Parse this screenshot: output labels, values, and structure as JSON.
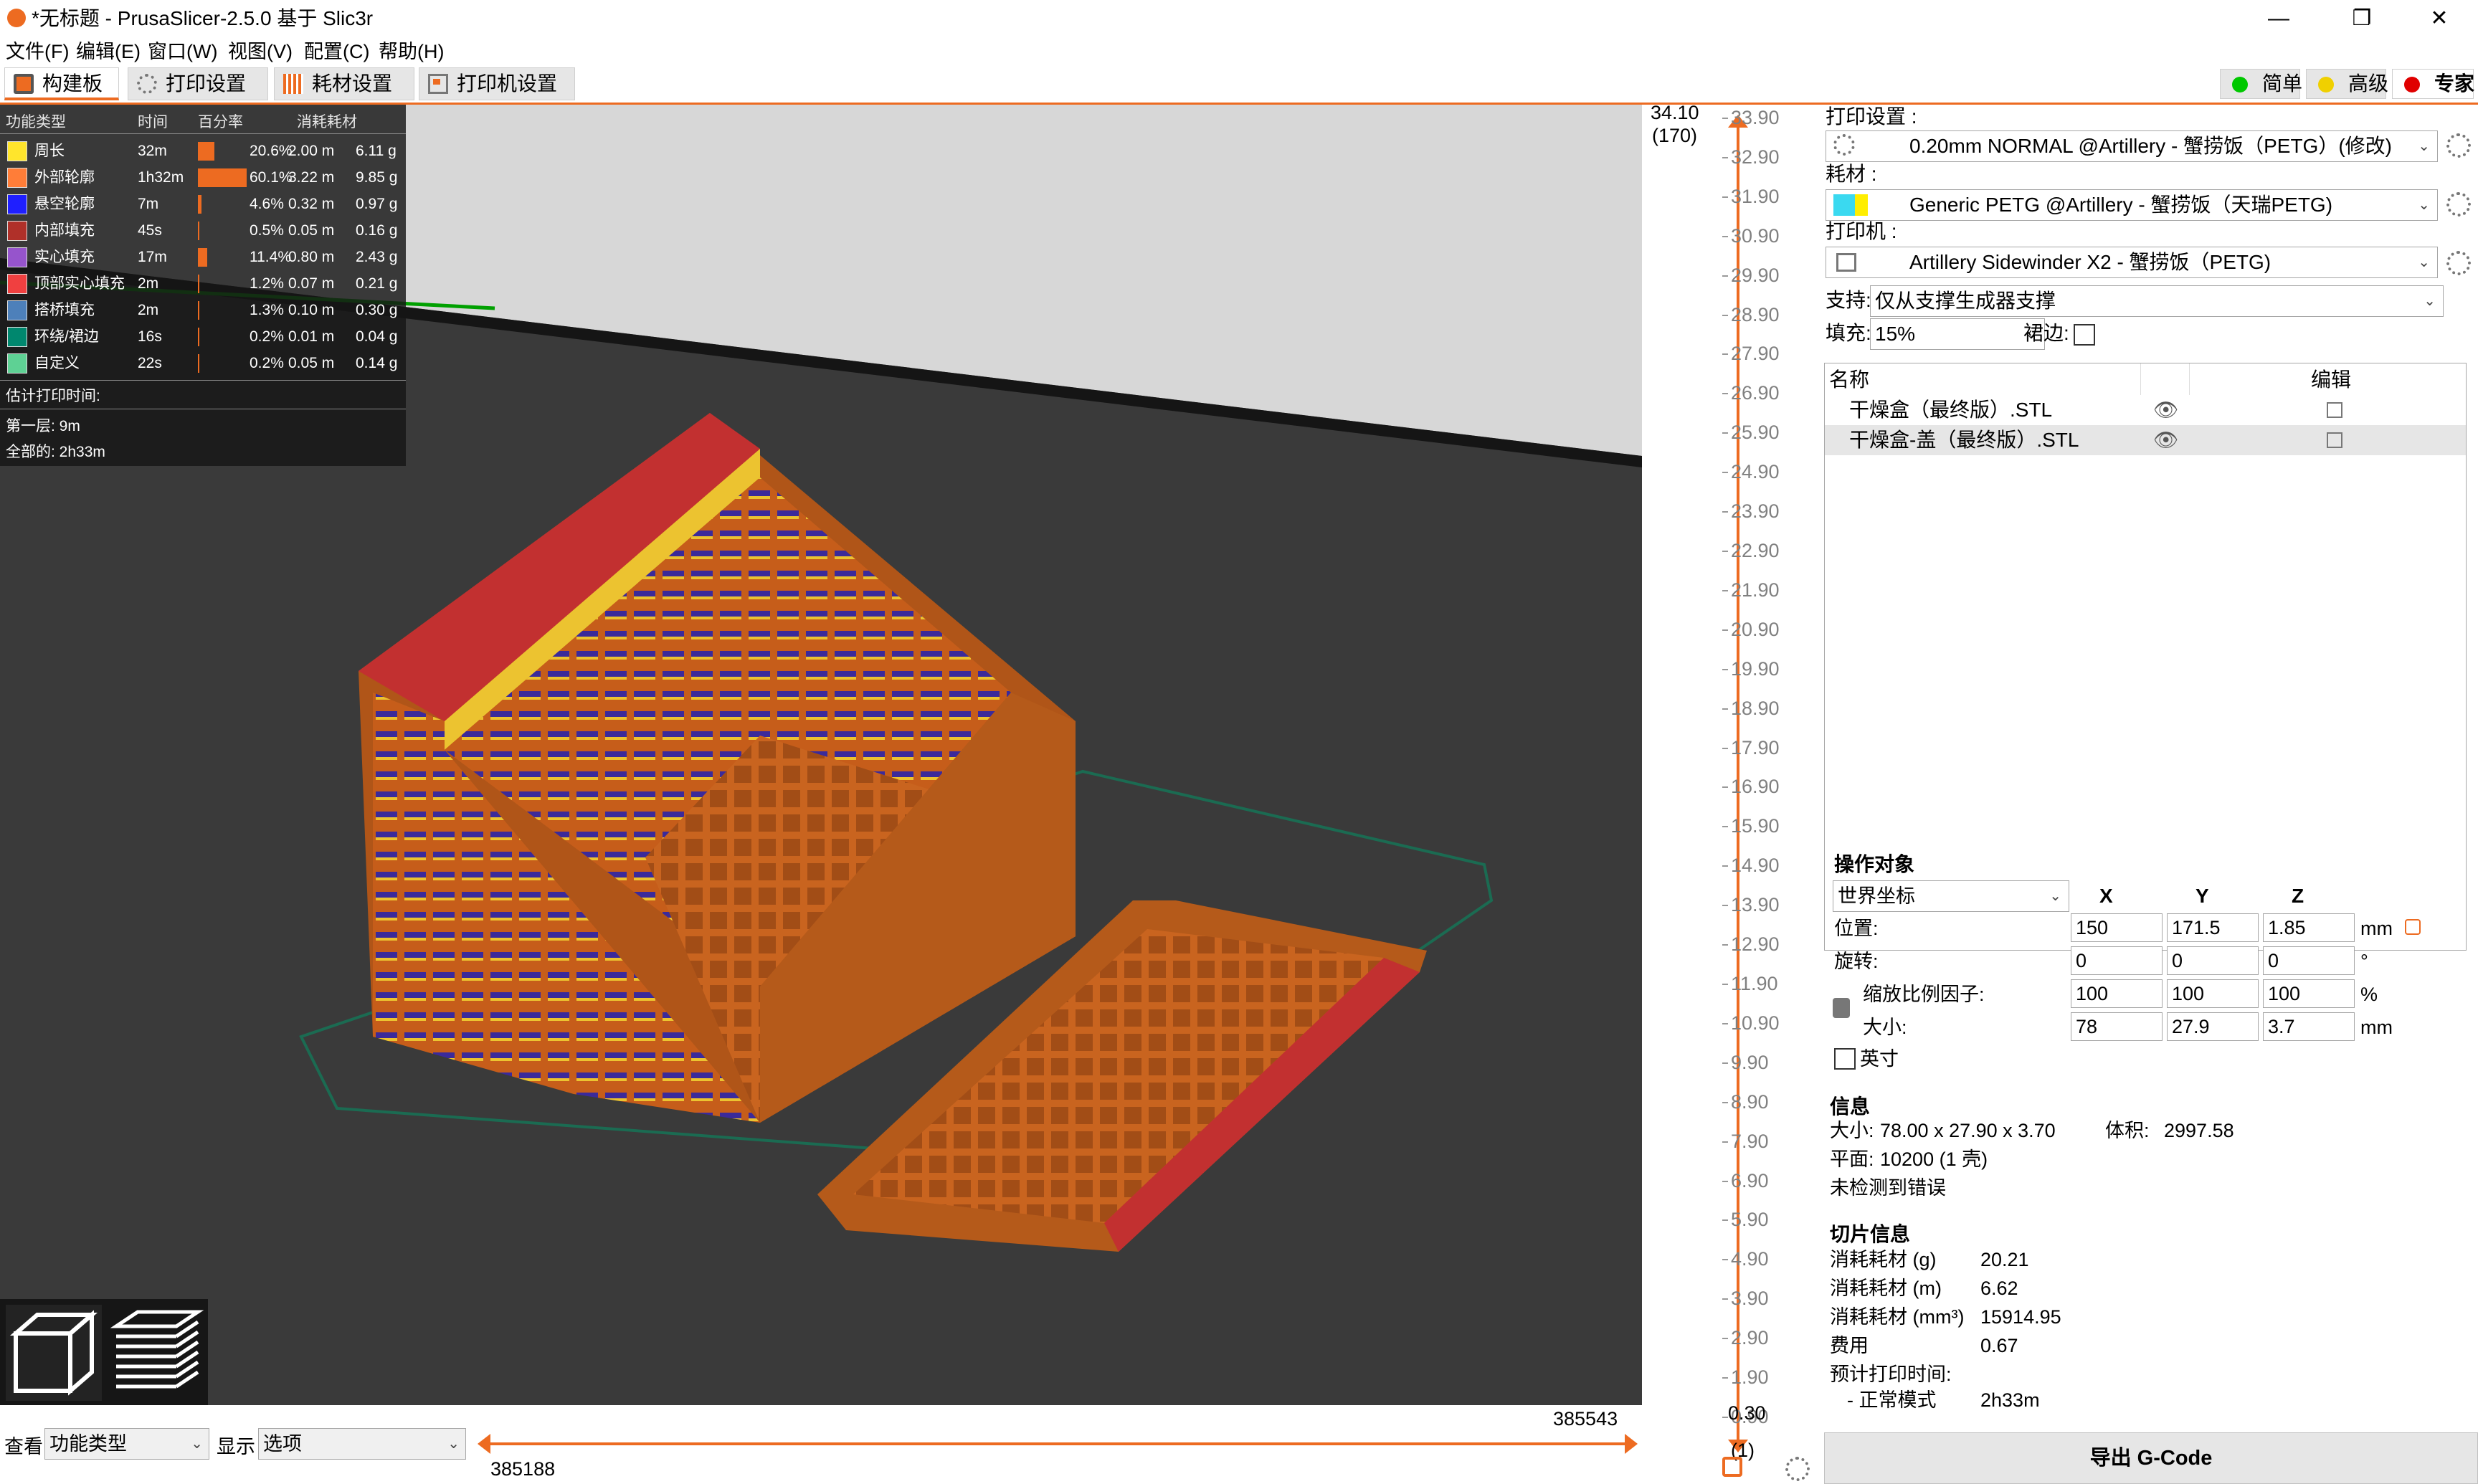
{
  "window": {
    "title": "*无标题 - PrusaSlicer-2.5.0 基于 Slic3r",
    "minimize": "—",
    "restore": "❐",
    "close": "✕"
  },
  "menu": [
    "文件(F)",
    "编辑(E)",
    "窗口(W)",
    "视图(V)",
    "配置(C)",
    "帮助(H)"
  ],
  "tabs": [
    {
      "label": "构建板",
      "active": true
    },
    {
      "label": "打印设置",
      "active": false
    },
    {
      "label": "耗材设置",
      "active": false
    },
    {
      "label": "打印机设置",
      "active": false
    }
  ],
  "modes": [
    {
      "label": "简单",
      "color": "#00c800"
    },
    {
      "label": "高级",
      "color": "#f0d000"
    },
    {
      "label": "专家",
      "color": "#e00000"
    }
  ],
  "legend": {
    "headers": {
      "type": "功能类型",
      "time": "时间",
      "percent": "百分率",
      "used": "消耗耗材"
    },
    "rows": [
      {
        "name": "周长",
        "time": "32m",
        "percent": "20.6%",
        "percent_value": 20.6,
        "length": "2.00 m",
        "weight": "6.11 g",
        "color": "#ffe52c"
      },
      {
        "name": "外部轮廓",
        "time": "1h32m",
        "percent": "60.1%",
        "percent_value": 60.1,
        "length": "3.22 m",
        "weight": "9.85 g",
        "color": "#ff7d38"
      },
      {
        "name": "悬空轮廓",
        "time": "7m",
        "percent": "4.6%",
        "percent_value": 4.6,
        "length": "0.32 m",
        "weight": "0.97 g",
        "color": "#1f1fff"
      },
      {
        "name": "内部填充",
        "time": "45s",
        "percent": "0.5%",
        "percent_value": 0.5,
        "length": "0.05 m",
        "weight": "0.16 g",
        "color": "#b03029"
      },
      {
        "name": "实心填充",
        "time": "17m",
        "percent": "11.4%",
        "percent_value": 11.4,
        "length": "0.80 m",
        "weight": "2.43 g",
        "color": "#9654cc"
      },
      {
        "name": "顶部实心填充",
        "time": "2m",
        "percent": "1.2%",
        "percent_value": 1.2,
        "length": "0.07 m",
        "weight": "0.21 g",
        "color": "#f04040"
      },
      {
        "name": "搭桥填充",
        "time": "2m",
        "percent": "1.3%",
        "percent_value": 1.3,
        "length": "0.10 m",
        "weight": "0.30 g",
        "color": "#4d80ba"
      },
      {
        "name": "环绕/裙边",
        "time": "16s",
        "percent": "0.2%",
        "percent_value": 0.2,
        "length": "0.01 m",
        "weight": "0.04 g",
        "color": "#00876e"
      },
      {
        "name": "自定义",
        "time": "22s",
        "percent": "0.2%",
        "percent_value": 0.2,
        "length": "0.05 m",
        "weight": "0.14 g",
        "color": "#5ed194"
      }
    ],
    "estimated_label": "估计打印时间:",
    "first_layer": "第一层: 9m",
    "total": "全部的: 2h33m"
  },
  "bottom": {
    "view_label": "查看",
    "view_value": "功能类型",
    "show_label": "显示",
    "show_value": "选项",
    "hslider_top": "385543",
    "hslider_bottom": "385188"
  },
  "vslider": {
    "top_value": "34.10",
    "top_layer": "(170)",
    "bottom_value": "0.30",
    "bottom_layer": "(1)",
    "ticks": [
      "33.90",
      "32.90",
      "31.90",
      "30.90",
      "29.90",
      "28.90",
      "27.90",
      "26.90",
      "25.90",
      "24.90",
      "23.90",
      "22.90",
      "21.90",
      "20.90",
      "19.90",
      "18.90",
      "17.90",
      "16.90",
      "15.90",
      "14.90",
      "13.90",
      "12.90",
      "11.90",
      "10.90",
      "9.90",
      "8.90",
      "7.90",
      "6.90",
      "5.90",
      "4.90",
      "3.90",
      "2.90",
      "1.90",
      "0.90"
    ]
  },
  "panel": {
    "print_settings_label": "打印设置 :",
    "print_settings_value": "0.20mm NORMAL @Artillery - 蟹捞饭（PETG）(修改)",
    "filament_label": "耗材 :",
    "filament_value": "Generic PETG @Artillery - 蟹捞饭（天瑞PETG)",
    "filament_colors": [
      "#3ad9f0",
      "#ffee00"
    ],
    "printer_label": "打印机 :",
    "printer_value": "Artillery Sidewinder X2 - 蟹捞饭（PETG)",
    "support_label": "支持:",
    "support_value": "仅从支撑生成器支撑",
    "infill_label": "填充:",
    "infill_value": "15%",
    "brim_label": "裙边:",
    "objects_header_name": "名称",
    "objects_header_edit": "编辑",
    "objects": [
      "干燥盒（最终版）.STL",
      "干燥盒-盖（最终版）.STL"
    ],
    "manipulation_title": "操作对象",
    "coord_value": "世界坐标",
    "axes": [
      "X",
      "Y",
      "Z"
    ],
    "position_label": "位置:",
    "position": [
      "150",
      "171.5",
      "1.85"
    ],
    "position_unit": "mm",
    "rotation_label": "旋转:",
    "rotation": [
      "0",
      "0",
      "0"
    ],
    "rotation_unit": "°",
    "scale_label": "缩放比例因子:",
    "scale": [
      "100",
      "100",
      "100"
    ],
    "scale_unit": "%",
    "size_label": "大小:",
    "size": [
      "78",
      "27.9",
      "3.7"
    ],
    "size_unit": "mm",
    "inches_label": "英寸",
    "info_title": "信息",
    "info_size_label": "大小:",
    "info_size": "78.00 x 27.90 x 3.70",
    "info_volume_label": "体积:",
    "info_volume": "2997.58",
    "info_facets_label": "平面:",
    "info_facets": "10200 (1 壳)",
    "info_errors": "未检测到错误",
    "slice_title": "切片信息",
    "slice_rows": [
      {
        "label": "消耗耗材 (g)",
        "value": "20.21"
      },
      {
        "label": "消耗耗材 (m)",
        "value": "6.62"
      },
      {
        "label": "消耗耗材 (mm³)",
        "value": "15914.95"
      },
      {
        "label": "费用",
        "value": "0.67"
      }
    ],
    "est_time_label": "预计打印时间:",
    "normal_mode_label": "- 正常模式",
    "normal_mode_value": "2h33m",
    "export_button": "导出 G-Code"
  }
}
